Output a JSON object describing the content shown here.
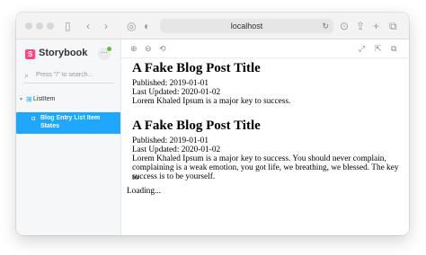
{
  "browser": {
    "address": "localhost"
  },
  "sidebar": {
    "logo": "S",
    "title": "Storybook",
    "menu_glyph": "···",
    "search_placeholder": "Press \"/\" to search...",
    "group": "ListItem",
    "story_line1": "Blog Entry List Item",
    "story_line2": "States"
  },
  "preview": {
    "posts": [
      {
        "title": "A Fake Blog Post Title",
        "published": "Published: 2019-01-01",
        "updated": "Last Updated: 2020-01-02",
        "body": "Lorem Khaled Ipsum is a major key to success."
      },
      {
        "title": "A Fake Blog Post Title",
        "published": "Published: 2019-01-01",
        "updated": "Last Updated: 2020-01-02",
        "body_lines": [
          "Lorem Khaled Ipsum is a major key to success. You should never complain,",
          "complaining is a weak emotion, you got life, we breathing, we blessed. The key to",
          "success is to be yourself."
        ]
      }
    ],
    "loading": "Loading..."
  },
  "colors": {
    "accent": "#1ea7fd",
    "brand": "#ff4785",
    "status_dot": "#66bf3c"
  },
  "icons": [
    "close-light",
    "minimize-light",
    "zoom-light",
    "sidebar-icon",
    "back-icon",
    "forward-icon",
    "site-icon",
    "shield-icon",
    "reload-icon",
    "download-icon",
    "share-icon",
    "new-tab-icon",
    "tabs-icon",
    "zoom-in-icon",
    "zoom-out-icon",
    "zoom-reset-icon",
    "fullscreen-icon",
    "open-new-icon",
    "copy-link-icon"
  ]
}
